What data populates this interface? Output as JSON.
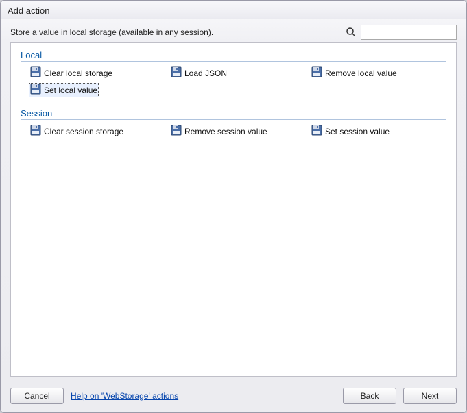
{
  "title": "Add action",
  "description": "Store a value in local storage (available in any session).",
  "search": {
    "placeholder": ""
  },
  "groups": [
    {
      "name": "Local",
      "items": [
        {
          "label": "Clear local storage",
          "selected": false
        },
        {
          "label": "Load JSON",
          "selected": false
        },
        {
          "label": "Remove local value",
          "selected": false
        },
        {
          "label": "Set local value",
          "selected": true
        }
      ]
    },
    {
      "name": "Session",
      "items": [
        {
          "label": "Clear session storage",
          "selected": false
        },
        {
          "label": "Remove session value",
          "selected": false
        },
        {
          "label": "Set session value",
          "selected": false
        }
      ]
    }
  ],
  "footer": {
    "cancel": "Cancel",
    "help": "Help on 'WebStorage' actions",
    "back": "Back",
    "next": "Next"
  }
}
